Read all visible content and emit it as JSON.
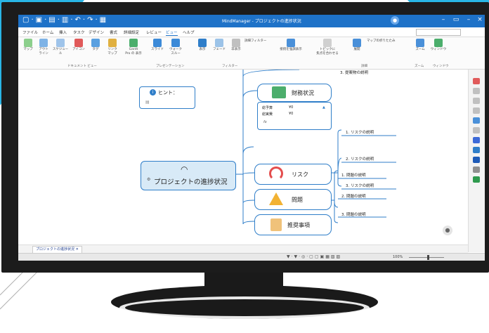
{
  "colors": {
    "accent": "#1e72c8",
    "topic_border": "#2f7ec9",
    "central_fill": "#d8eaf7",
    "banner": "#29b6e6"
  },
  "window": {
    "title": "MindManager - プロジェクトの進捗状況",
    "user_icon": "user-icon",
    "controls": [
      "–",
      "▭",
      "–",
      "×"
    ]
  },
  "menu": [
    "ファイル",
    "ホーム",
    "挿入",
    "タスク",
    "デザイン",
    "書式",
    "詳細設定",
    "レビュー",
    "ビュー",
    "ヘルプ"
  ],
  "active_menu": "ビュー",
  "ribbon": {
    "buttons": [
      {
        "label": "マップ",
        "icon": "map-icon"
      },
      {
        "label": "アウト\nライン",
        "icon": "outline-icon"
      },
      {
        "label": "スケジュール",
        "icon": "schedule-icon"
      },
      {
        "label": "アイコン",
        "icon": "icons-icon"
      },
      {
        "label": "タグ",
        "icon": "tag-icon"
      },
      {
        "label": "リンク\nマップ",
        "icon": "link-map-icon"
      },
      {
        "label": "Gantt\nPro の 表示",
        "icon": "gantt-icon"
      },
      {
        "label": "スライド",
        "icon": "slide-icon"
      },
      {
        "label": "ウォーク\nスルー",
        "icon": "walkthrough-icon"
      },
      {
        "label": "表示",
        "icon": "filter-show-icon"
      },
      {
        "label": "フェード",
        "icon": "filter-fade-icon"
      },
      {
        "label": "非表示",
        "icon": "filter-hide-icon"
      },
      {
        "label": "詳細フィルター",
        "icon": "adv-filter-icon"
      },
      {
        "label": "接続を強調表示",
        "icon": "highlight-icon"
      },
      {
        "label": "トピックに\n焦点を合わせる",
        "icon": "focus-icon"
      },
      {
        "label": "展開",
        "icon": "expand-icon"
      },
      {
        "label": "マップの折りたたみ",
        "icon": "collapse-icon"
      },
      {
        "label": "ズーム",
        "icon": "zoom-icon"
      },
      {
        "label": "ウィンドウ",
        "icon": "window-icon"
      }
    ],
    "groups": [
      "ドキュメント ビュー",
      "プレゼンテーション",
      "フィルター",
      "詳細",
      "ズーム",
      "ウィンドウ"
    ]
  },
  "map": {
    "hint_label": "ヒント：",
    "central": "プロジェクトの進捗状況",
    "top_item": "3. 提案物の説明",
    "finance": {
      "title": "財務状況",
      "rows": [
        {
          "label": "総予算",
          "value": "¥0"
        },
        {
          "label": "総実費",
          "value": "¥0"
        }
      ],
      "formula": "fx"
    },
    "risk": {
      "title": "リスク",
      "items": [
        "1. リスクの説明",
        "2. リスクの説明",
        "3. リスクの説明"
      ]
    },
    "issues": {
      "title": "問題",
      "items": [
        "1. 問題の説明",
        "2. 問題の説明",
        "3. 問題の説明"
      ]
    },
    "recommend": {
      "title": "推奨事項"
    }
  },
  "tab": {
    "label": "プロジェクトの進捗状況"
  },
  "status": {
    "zoom": "100%"
  }
}
